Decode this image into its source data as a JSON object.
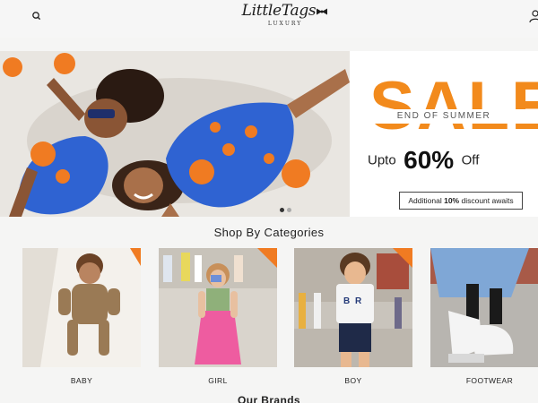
{
  "header": {
    "logo_main": "LittleTags",
    "logo_sub": "LUXURY",
    "search_icon": "search-icon",
    "account_icon": "user-icon"
  },
  "hero": {
    "sale_word": "SALE",
    "subtitle": "END OF SUMMER",
    "upto_prefix": "Upto",
    "upto_value": "60%",
    "upto_suffix": "Off",
    "cta_prefix": "Additional ",
    "cta_bold": "10%",
    "cta_suffix": " discount awaits",
    "slides_count": 2,
    "active_slide": 1,
    "accent_color": "#f28a1c"
  },
  "categories": {
    "title": "Shop By Categories",
    "items": [
      {
        "label": "BABY"
      },
      {
        "label": "GIRL"
      },
      {
        "label": "BOY"
      },
      {
        "label": "FOOTWEAR"
      }
    ]
  },
  "brands": {
    "title": "Our Brands"
  }
}
